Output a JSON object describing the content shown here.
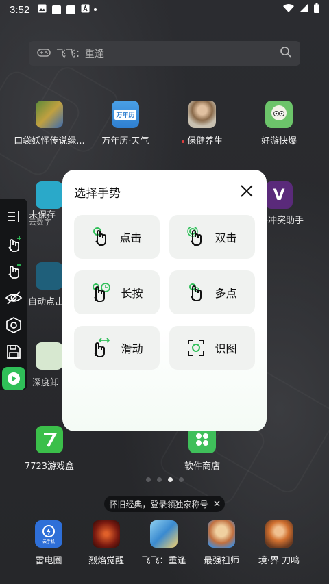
{
  "status_bar": {
    "time": "3:52"
  },
  "search": {
    "placeholder": "飞飞：重逢"
  },
  "home_apps": [
    {
      "label": "口袋妖怪传说绿..."
    },
    {
      "label": "万年历·天气",
      "icon_text": "万年历"
    },
    {
      "label": "保健养生"
    },
    {
      "label": "好游快爆"
    }
  ],
  "behind_dialog": {
    "unsaved": "未保存",
    "cloud": "云数字",
    "auto_click": "自动点击",
    "deep_uninstall": "深度卸",
    "conflict_helper": "格冲突助手"
  },
  "lower_apps": [
    {
      "label": "7723游戏盒"
    },
    {
      "label": "软件商店"
    }
  ],
  "dialog": {
    "title": "选择手势",
    "buttons": [
      {
        "label": "点击",
        "icon": "tap-hand-icon"
      },
      {
        "label": "双击",
        "icon": "double-tap-hand-icon"
      },
      {
        "label": "长按",
        "icon": "long-press-hand-icon"
      },
      {
        "label": "多点",
        "icon": "multi-touch-hand-icon"
      },
      {
        "label": "滑动",
        "icon": "swipe-hand-icon"
      },
      {
        "label": "识图",
        "icon": "image-recognition-icon"
      }
    ]
  },
  "tip": {
    "text": "怀旧经典，登录领独家称号"
  },
  "dock": [
    {
      "label": "雷电圈",
      "icon_text": "云手机"
    },
    {
      "label": "烈焰觉醒"
    },
    {
      "label": "飞飞：重逢"
    },
    {
      "label": "最强祖师"
    },
    {
      "label": "境·界 刀鸣"
    }
  ],
  "colors": {
    "accent": "#2fbf58",
    "dialog_bg": "#ffffff",
    "button_bg": "#f0f2f0"
  }
}
